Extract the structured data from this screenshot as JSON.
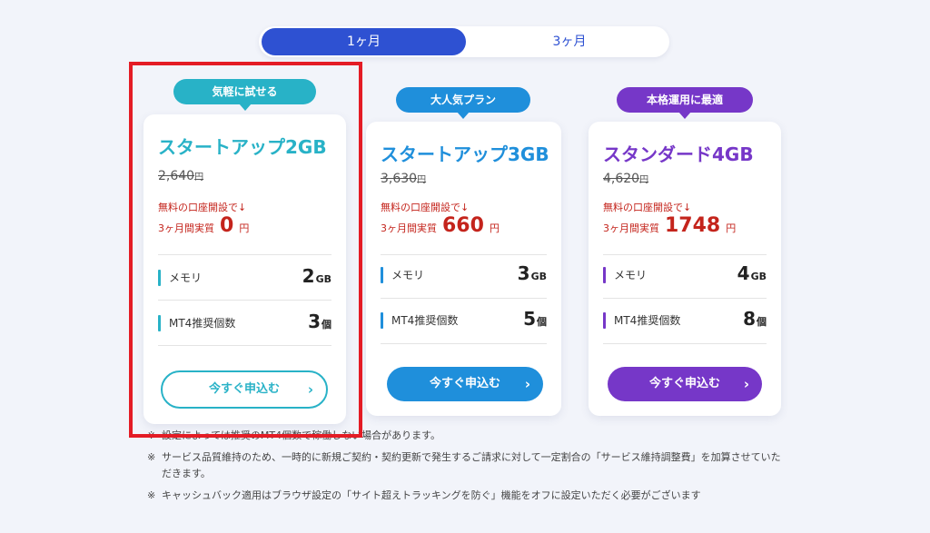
{
  "toggle": {
    "option_1": "1ヶ月",
    "option_2": "3ヶ月"
  },
  "plans": [
    {
      "badge": "気軽に試せる",
      "name": "スタートアップ2GB",
      "original_price": "2,640",
      "yen": "円",
      "promo": "無料の口座開設で↓",
      "effective_prefix": "3ヶ月間実質",
      "effective_value": "0",
      "effective_unit": "円",
      "memory_label": "メモリ",
      "memory_value": "2",
      "memory_unit": "GB",
      "mt4_label": "MT4推奨個数",
      "mt4_value": "3",
      "mt4_unit": "個",
      "cta": "今すぐ申込む",
      "color": "#28b2c7"
    },
    {
      "badge": "大人気プラン",
      "name": "スタートアップ3GB",
      "original_price": "3,630",
      "yen": "円",
      "promo": "無料の口座開設で↓",
      "effective_prefix": "3ヶ月間実質",
      "effective_value": "660",
      "effective_unit": "円",
      "memory_label": "メモリ",
      "memory_value": "3",
      "memory_unit": "GB",
      "mt4_label": "MT4推奨個数",
      "mt4_value": "5",
      "mt4_unit": "個",
      "cta": "今すぐ申込む",
      "color": "#1f8fdb"
    },
    {
      "badge": "本格運用に最適",
      "name": "スタンダード4GB",
      "original_price": "4,620",
      "yen": "円",
      "promo": "無料の口座開設で↓",
      "effective_prefix": "3ヶ月間実質",
      "effective_value": "1748",
      "effective_unit": "円",
      "memory_label": "メモリ",
      "memory_value": "4",
      "memory_unit": "GB",
      "mt4_label": "MT4推奨個数",
      "mt4_value": "8",
      "mt4_unit": "個",
      "cta": "今すぐ申込む",
      "color": "#7637c8"
    }
  ],
  "notes": {
    "mark": "※",
    "note_1": "設定によっては推奨のMT4個数で稼働しない場合があります。",
    "note_2": "サービス品質維持のため、一時的に新規ご契約・契約更新で発生するご請求に対して一定割合の「サービス維持調整費」を加算させていただきます。",
    "note_3": "キャッシュバック適用はブラウザ設定の「サイト超えトラッキングを防ぐ」機能をオフに設定いただく必要がございます"
  },
  "chevron": "›",
  "colors": {
    "accent_toggle": "#2e51d2",
    "highlight_border": "#e41c25",
    "promo_red": "#c4241c"
  }
}
